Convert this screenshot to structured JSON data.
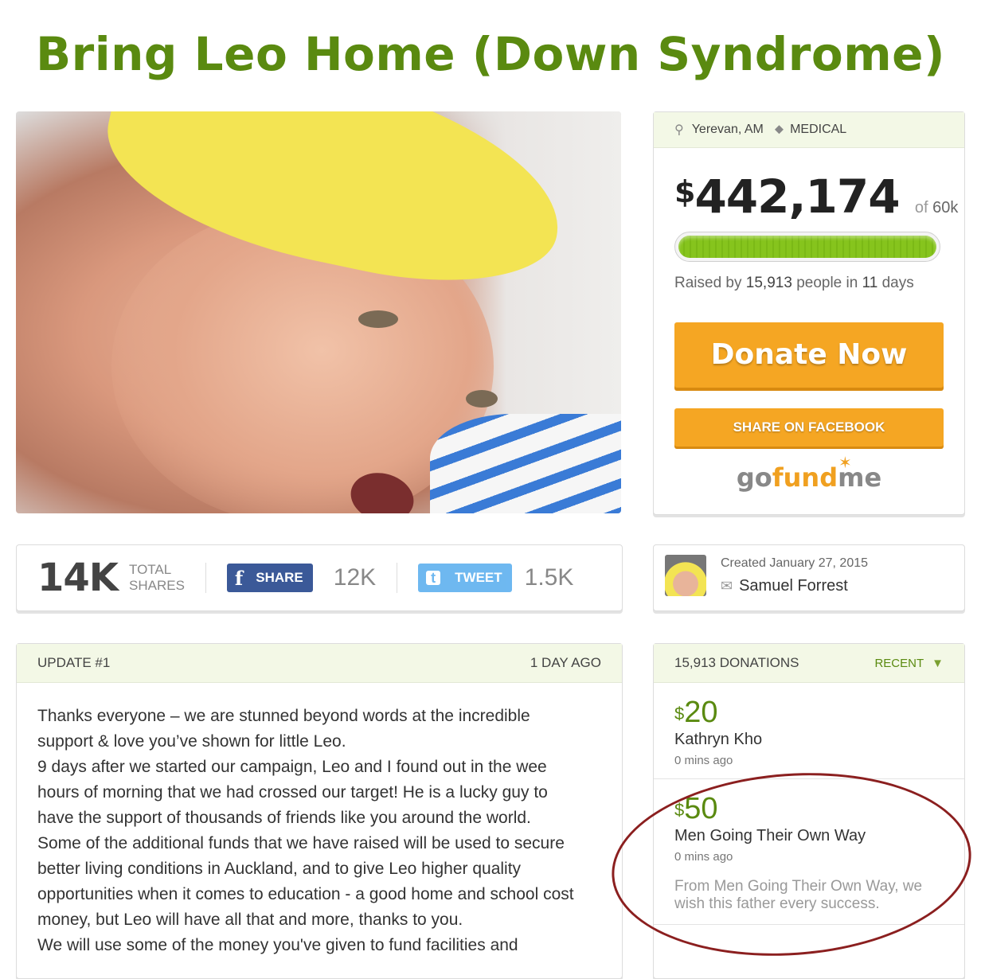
{
  "page": {
    "title": "Bring Leo Home (Down Syndrome)"
  },
  "campaign": {
    "location": "Yerevan, AM",
    "category": "MEDICAL",
    "amount_currency": "$",
    "amount": "442,174",
    "goal_prefix": "of",
    "goal": "60k",
    "progress_percent": 100,
    "raised_prefix": "Raised by",
    "raised_people": "15,913",
    "raised_mid": "people in",
    "raised_days": "11",
    "raised_suffix": "days",
    "donate_label": "Donate Now",
    "share_facebook_label": "SHARE ON FACEBOOK",
    "brand": {
      "go": "go",
      "fund": "fund",
      "me": "me"
    }
  },
  "shares": {
    "total": "14K",
    "total_label_1": "TOTAL",
    "total_label_2": "SHARES",
    "facebook_label": "SHARE",
    "facebook_count": "12K",
    "twitter_label": "TWEET",
    "twitter_count": "1.5K"
  },
  "creator": {
    "created": "Created January 27, 2015",
    "name": "Samuel Forrest"
  },
  "update": {
    "title": "UPDATE #1",
    "time": "1 DAY AGO",
    "lines": [
      "Thanks everyone – we are stunned beyond words at the incredible",
      "support & love you’ve shown for little Leo.",
      "9 days after we started our campaign, Leo and I found out in the wee",
      "hours of morning that we had crossed our target! He is a lucky guy to",
      "have the support of thousands of friends like you around the world.",
      "Some of the additional funds that we have raised will be used to secure",
      "better living conditions in Auckland, and to give Leo higher quality",
      "opportunities when it comes to education - a good home and school cost",
      "money, but Leo will have all that and more, thanks to you.",
      "We will use some of the money you've given to fund facilities and"
    ]
  },
  "donations": {
    "header": "15,913 DONATIONS",
    "sort_label": "RECENT",
    "items": [
      {
        "currency": "$",
        "amount": "20",
        "name": "Kathryn Kho",
        "time": "0 mins ago",
        "message": ""
      },
      {
        "currency": "$",
        "amount": "50",
        "name": "Men Going Their Own Way",
        "time": "0 mins ago",
        "message": "From Men Going Their Own Way, we wish this father every success."
      }
    ]
  },
  "colors": {
    "brand_green": "#5a8a10",
    "donate_orange": "#f5a623",
    "facebook_blue": "#3b5998",
    "twitter_blue": "#55acee",
    "annotation_red": "#8b1f1f"
  }
}
